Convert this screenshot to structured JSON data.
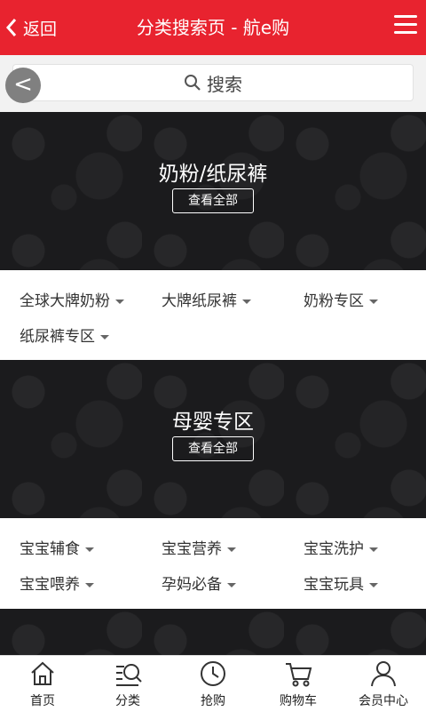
{
  "header": {
    "back_label": "返回",
    "title": "分类搜索页 - 航e购",
    "color": "#e8232f"
  },
  "search": {
    "placeholder": "搜索",
    "float_back": "<"
  },
  "sections": [
    {
      "title": "奶粉/纸尿裤",
      "view_all": "查看全部",
      "categories": [
        "全球大牌奶粉",
        "大牌纸尿裤",
        "奶粉专区",
        "纸尿裤专区"
      ]
    },
    {
      "title": "母婴专区",
      "view_all": "查看全部",
      "categories": [
        "宝宝辅食",
        "宝宝营养",
        "宝宝洗护",
        "宝宝喂养",
        "孕妈必备",
        "宝宝玩具"
      ]
    }
  ],
  "tabbar": [
    {
      "label": "首页",
      "icon": "home-icon"
    },
    {
      "label": "分类",
      "icon": "category-search-icon"
    },
    {
      "label": "抢购",
      "icon": "clock-icon"
    },
    {
      "label": "购物车",
      "icon": "cart-icon"
    },
    {
      "label": "会员中心",
      "icon": "user-icon"
    }
  ]
}
